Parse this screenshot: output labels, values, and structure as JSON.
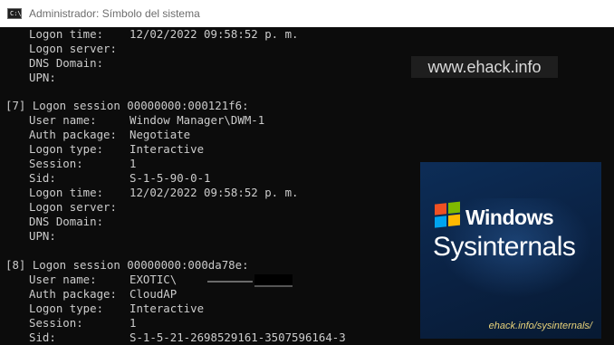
{
  "window": {
    "title": "Administrador: Símbolo del sistema",
    "icon": "cmd-icon",
    "icon_glyph": "C:\\"
  },
  "console": {
    "session_a": {
      "logon_time_label": "Logon time:",
      "logon_time": "12/02/2022 09:58:52 p. m.",
      "logon_server_label": "Logon server:",
      "logon_server": "",
      "dns_domain_label": "DNS Domain:",
      "dns_domain": "",
      "upn_label": "UPN:",
      "upn": ""
    },
    "session_7": {
      "header": "[7] Logon session 00000000:000121f6:",
      "user_name_label": "User name:",
      "user_name": "Window Manager\\DWM-1",
      "auth_package_label": "Auth package:",
      "auth_package": "Negotiate",
      "logon_type_label": "Logon type:",
      "logon_type": "Interactive",
      "session_label": "Session:",
      "session": "1",
      "sid_label": "Sid:",
      "sid": "S-1-5-90-0-1",
      "logon_time_label": "Logon time:",
      "logon_time": "12/02/2022 09:58:52 p. m.",
      "logon_server_label": "Logon server:",
      "logon_server": "",
      "dns_domain_label": "DNS Domain:",
      "dns_domain": "",
      "upn_label": "UPN:",
      "upn": ""
    },
    "session_8": {
      "header": "[8] Logon session 00000000:000da78e:",
      "user_name_label": "User name:",
      "user_name": "EXOTIC\\",
      "auth_package_label": "Auth package:",
      "auth_package": "CloudAP",
      "logon_type_label": "Logon type:",
      "logon_type": "Interactive",
      "session_label": "Session:",
      "session": "1",
      "sid_label": "Sid:",
      "sid": "S-1-5-21-2698529161-3507596164-3"
    }
  },
  "watermark": {
    "text": "www.ehack.info"
  },
  "banner": {
    "brand_line1": "Windows",
    "brand_line2": "Sysinternals",
    "url": "ehack.info/sysinternals/",
    "logo_icon": "windows-flag-icon"
  },
  "colors": {
    "console_bg": "#0c0c0c",
    "console_text": "#cccccc",
    "titlebar_bg": "#ffffff",
    "banner_bg": "#0a2142",
    "banner_url": "#e8d27a"
  }
}
